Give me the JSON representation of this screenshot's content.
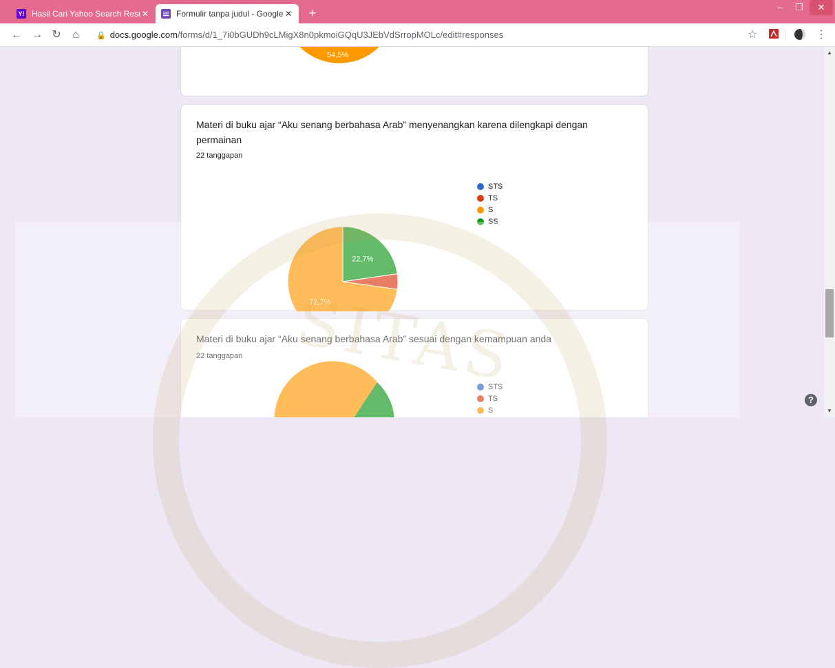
{
  "browser": {
    "tabs": [
      {
        "title": "Hasil Cari Yahoo Search Results",
        "favicon": "yahoo-icon",
        "favicon_text": "Y!",
        "favicon_color": "#6001d2",
        "active": false
      },
      {
        "title": "Formulir tanpa judul - Google Fo",
        "favicon": "google-forms-icon",
        "favicon_color": "#7248b9",
        "active": true
      }
    ],
    "new_tab_label": "+",
    "url_host": "docs.google.com",
    "url_path": "/forms/d/1_7i0bGUDh9cLMigX8n0pkmoiGQqU3JEbVdSrropMOLc/edit#responses",
    "tab_color": "#e46a8e"
  },
  "cards": {
    "top": {
      "slice_label": "54,5%"
    },
    "q1": {
      "title": "Materi di buku ajar “Aku senang berbahasa Arab” menyenangkan karena dilengkapi dengan permainan",
      "count": "22 tanggapan"
    },
    "q2": {
      "title": "Materi di buku ajar “Aku senang berbahasa Arab” sesuai dengan kemampuan anda",
      "count": "22 tanggapan"
    }
  },
  "legend": [
    {
      "label": "STS",
      "color": "#3366cc"
    },
    {
      "label": "TS",
      "color": "#dc3912"
    },
    {
      "label": "S",
      "color": "#ff9900"
    },
    {
      "label": "SS",
      "color": "#109618"
    }
  ],
  "chart_data": [
    {
      "type": "pie",
      "title": "Materi di buku ajar “Aku senang berbahasa Arab” menyenangkan karena dilengkapi dengan permainan",
      "categories": [
        "STS",
        "TS",
        "S",
        "SS"
      ],
      "values": [
        0,
        4.5,
        72.7,
        22.7
      ],
      "data_labels": [
        "",
        "",
        "72,7%",
        "22,7%"
      ],
      "legend": "right"
    }
  ]
}
